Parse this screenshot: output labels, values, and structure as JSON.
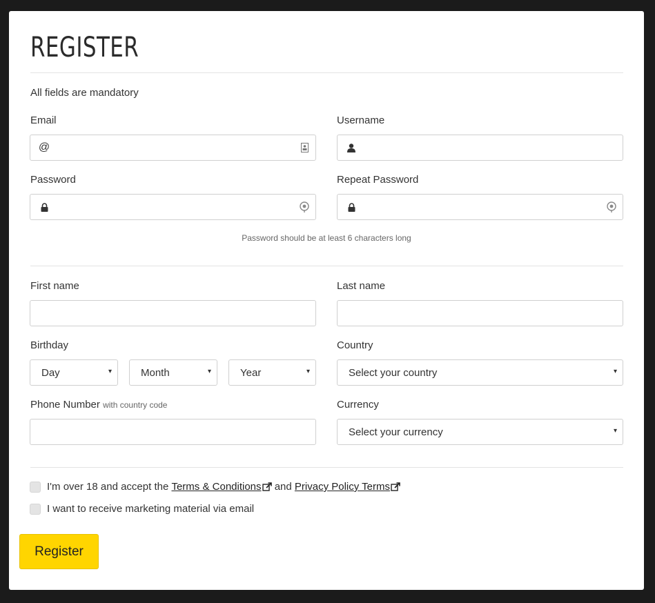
{
  "form": {
    "title": "REGISTER",
    "mandatory_note": "All fields are mandatory",
    "email": {
      "label": "Email",
      "at_symbol": "@",
      "value": ""
    },
    "username": {
      "label": "Username",
      "value": ""
    },
    "password": {
      "label": "Password",
      "value": ""
    },
    "repeat_password": {
      "label": "Repeat Password",
      "value": ""
    },
    "password_hint": "Password should be at least 6 characters long",
    "first_name": {
      "label": "First name",
      "value": ""
    },
    "last_name": {
      "label": "Last name",
      "value": ""
    },
    "birthday": {
      "label": "Birthday",
      "day": "Day",
      "month": "Month",
      "year": "Year"
    },
    "country": {
      "label": "Country",
      "selected": "Select your country"
    },
    "phone": {
      "label": "Phone Number",
      "sublabel": "with country code",
      "value": ""
    },
    "currency": {
      "label": "Currency",
      "selected": "Select your currency"
    },
    "terms": {
      "prefix": "I'm over 18 and accept the ",
      "terms_link": "Terms & Conditions",
      "middle": " and ",
      "privacy_link": "Privacy Policy Terms"
    },
    "marketing_label": "I want to receive marketing material via email",
    "submit_label": "Register"
  },
  "colors": {
    "background": "#1b1b1b",
    "panel": "#ffffff",
    "accent": "#ffd500"
  },
  "icons": {
    "caret": "▾"
  }
}
